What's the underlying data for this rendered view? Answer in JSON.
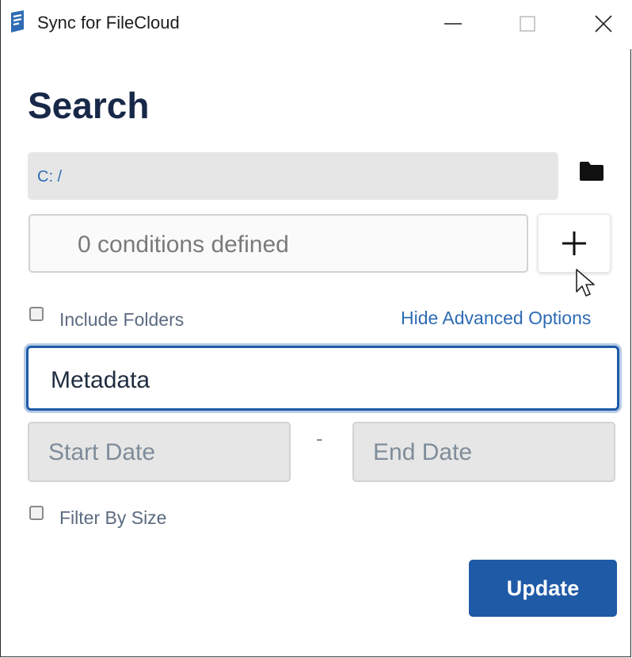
{
  "window": {
    "title": "Sync for FileCloud",
    "controls": [
      "minimize",
      "maximize",
      "close"
    ]
  },
  "page": {
    "heading": "Search"
  },
  "path": {
    "value": "C: /",
    "browse_icon": "folder-icon"
  },
  "conditions": {
    "summary": "0 conditions defined",
    "add_icon": "plus-icon"
  },
  "options": {
    "include_folders_label": "Include Folders",
    "include_folders_checked": false,
    "advanced_link": "Hide Advanced Options",
    "filter_by_size_label": "Filter By Size",
    "filter_by_size_checked": false
  },
  "metadata": {
    "value": "Metadata"
  },
  "dates": {
    "start_placeholder": "Start Date",
    "separator": "-",
    "end_placeholder": "End Date"
  },
  "actions": {
    "update_label": "Update"
  },
  "colors": {
    "accent": "#1f5aa6",
    "heading": "#182848",
    "link": "#2e6bb3"
  }
}
